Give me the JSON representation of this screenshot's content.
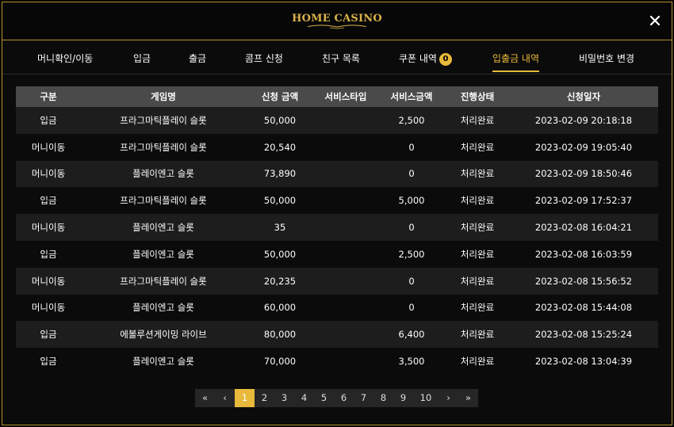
{
  "header": {
    "logo_text": "HOME CASINO",
    "accent_color": "#e8b93a",
    "close_icon": "close-icon"
  },
  "tabs": [
    {
      "label": "머니확인/이동"
    },
    {
      "label": "입금"
    },
    {
      "label": "출금"
    },
    {
      "label": "콤프 신청"
    },
    {
      "label": "친구 목록"
    },
    {
      "label": "쿠폰 내역",
      "badge": "0"
    },
    {
      "label": "입출금 내역",
      "active": true
    },
    {
      "label": "비밀번호 변경"
    }
  ],
  "table": {
    "columns": [
      "구분",
      "게임명",
      "신청 금액",
      "서비스타입",
      "서비스금액",
      "진행상태",
      "신청일자"
    ],
    "rows": [
      [
        "입금",
        "프라그마틱플레이 슬롯",
        "50,000",
        "",
        "2,500",
        "처리완료",
        "2023-02-09 20:18:18"
      ],
      [
        "머니이동",
        "프라그마틱플레이 슬롯",
        "20,540",
        "",
        "0",
        "처리완료",
        "2023-02-09 19:05:40"
      ],
      [
        "머니이동",
        "플레이엔고 슬롯",
        "73,890",
        "",
        "0",
        "처리완료",
        "2023-02-09 18:50:46"
      ],
      [
        "입금",
        "프라그마틱플레이 슬롯",
        "50,000",
        "",
        "5,000",
        "처리완료",
        "2023-02-09 17:52:37"
      ],
      [
        "머니이동",
        "플레이엔고 슬롯",
        "35",
        "",
        "0",
        "처리완료",
        "2023-02-08 16:04:21"
      ],
      [
        "입금",
        "플레이엔고 슬롯",
        "50,000",
        "",
        "2,500",
        "처리완료",
        "2023-02-08 16:03:59"
      ],
      [
        "머니이동",
        "프라그마틱플레이 슬롯",
        "20,235",
        "",
        "0",
        "처리완료",
        "2023-02-08 15:56:52"
      ],
      [
        "머니이동",
        "플레이엔고 슬롯",
        "60,000",
        "",
        "0",
        "처리완료",
        "2023-02-08 15:44:08"
      ],
      [
        "입금",
        "에볼루션게이밍 라이브",
        "80,000",
        "",
        "6,400",
        "처리완료",
        "2023-02-08 15:25:24"
      ],
      [
        "입금",
        "플레이엔고 슬롯",
        "70,000",
        "",
        "3,500",
        "처리완료",
        "2023-02-08 13:04:39"
      ]
    ]
  },
  "pagination": {
    "first": "«",
    "prev": "‹",
    "pages": [
      "1",
      "2",
      "3",
      "4",
      "5",
      "6",
      "7",
      "8",
      "9",
      "10"
    ],
    "current": "1",
    "next": "›",
    "last": "»"
  }
}
